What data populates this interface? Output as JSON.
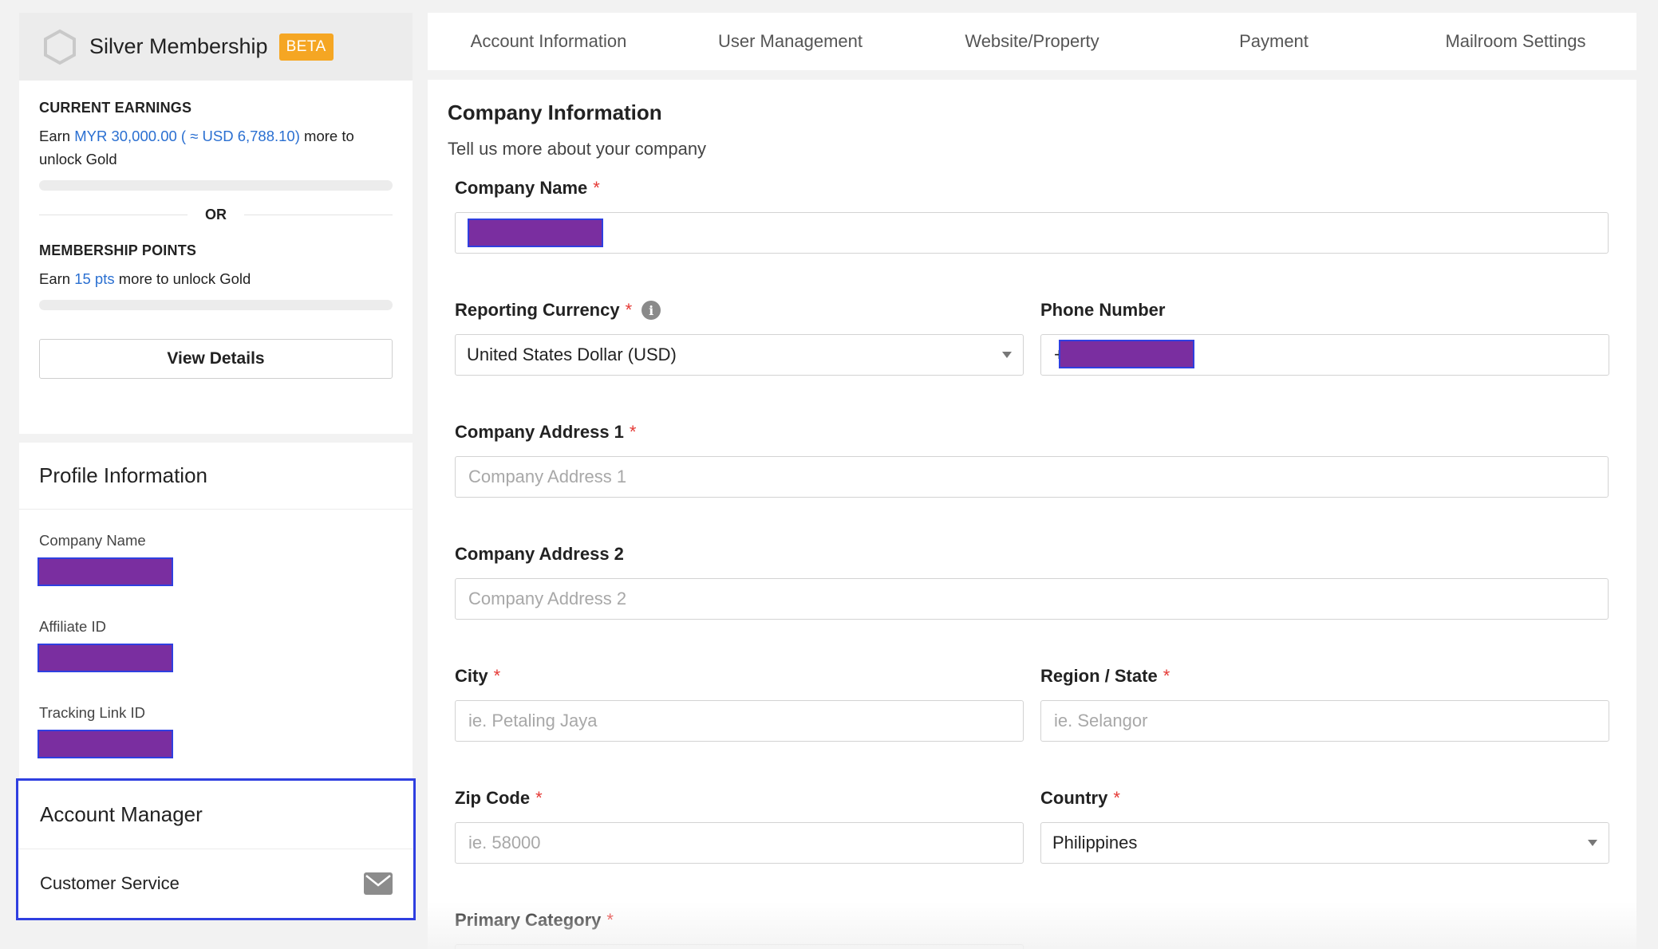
{
  "membership": {
    "title": "Silver Membership",
    "badge": "BETA",
    "earnings_title": "CURRENT EARNINGS",
    "earnings_prefix": "Earn ",
    "earnings_amount": "MYR 30,000.00 ( ≈ USD 6,788.10)",
    "earnings_suffix": " more to unlock Gold",
    "earnings_progress": 0,
    "or_label": "OR",
    "points_title": "MEMBERSHIP POINTS",
    "points_prefix": "Earn ",
    "points_amount": "15 pts",
    "points_suffix": " more to unlock Gold",
    "points_progress": 0,
    "view_details": "View Details"
  },
  "profile": {
    "title": "Profile Information",
    "company_name_label": "Company Name",
    "affiliate_id_label": "Affiliate ID",
    "tracking_link_label": "Tracking Link ID"
  },
  "account_manager": {
    "title": "Account Manager",
    "service_label": "Customer Service"
  },
  "tabs": [
    {
      "label": "Account Information",
      "active": true
    },
    {
      "label": "User Management",
      "active": false
    },
    {
      "label": "Website/Property",
      "active": false
    },
    {
      "label": "Payment",
      "active": false
    },
    {
      "label": "Mailroom Settings",
      "active": false
    }
  ],
  "form": {
    "title": "Company Information",
    "subtitle": "Tell us more about your company",
    "required_mark": "*",
    "company_name": {
      "label": "Company Name"
    },
    "reporting_currency": {
      "label": "Reporting Currency",
      "value": "United States Dollar (USD)",
      "info": "i"
    },
    "phone_number": {
      "label": "Phone Number",
      "prefix": "+"
    },
    "address1": {
      "label": "Company Address 1",
      "placeholder": "Company Address 1"
    },
    "address2": {
      "label": "Company Address 2",
      "placeholder": "Company Address 2"
    },
    "city": {
      "label": "City",
      "placeholder": "ie. Petaling Jaya"
    },
    "region": {
      "label": "Region / State",
      "placeholder": "ie. Selangor"
    },
    "zip": {
      "label": "Zip Code",
      "placeholder": "ie. 58000"
    },
    "country": {
      "label": "Country",
      "value": "Philippines"
    },
    "primary_category": {
      "label": "Primary Category"
    }
  },
  "colors": {
    "accent": "#f5a623",
    "link": "#2a6fd1",
    "required": "#e53935",
    "redaction": "#7a2ea0",
    "highlight_border": "#2f3fe0"
  }
}
